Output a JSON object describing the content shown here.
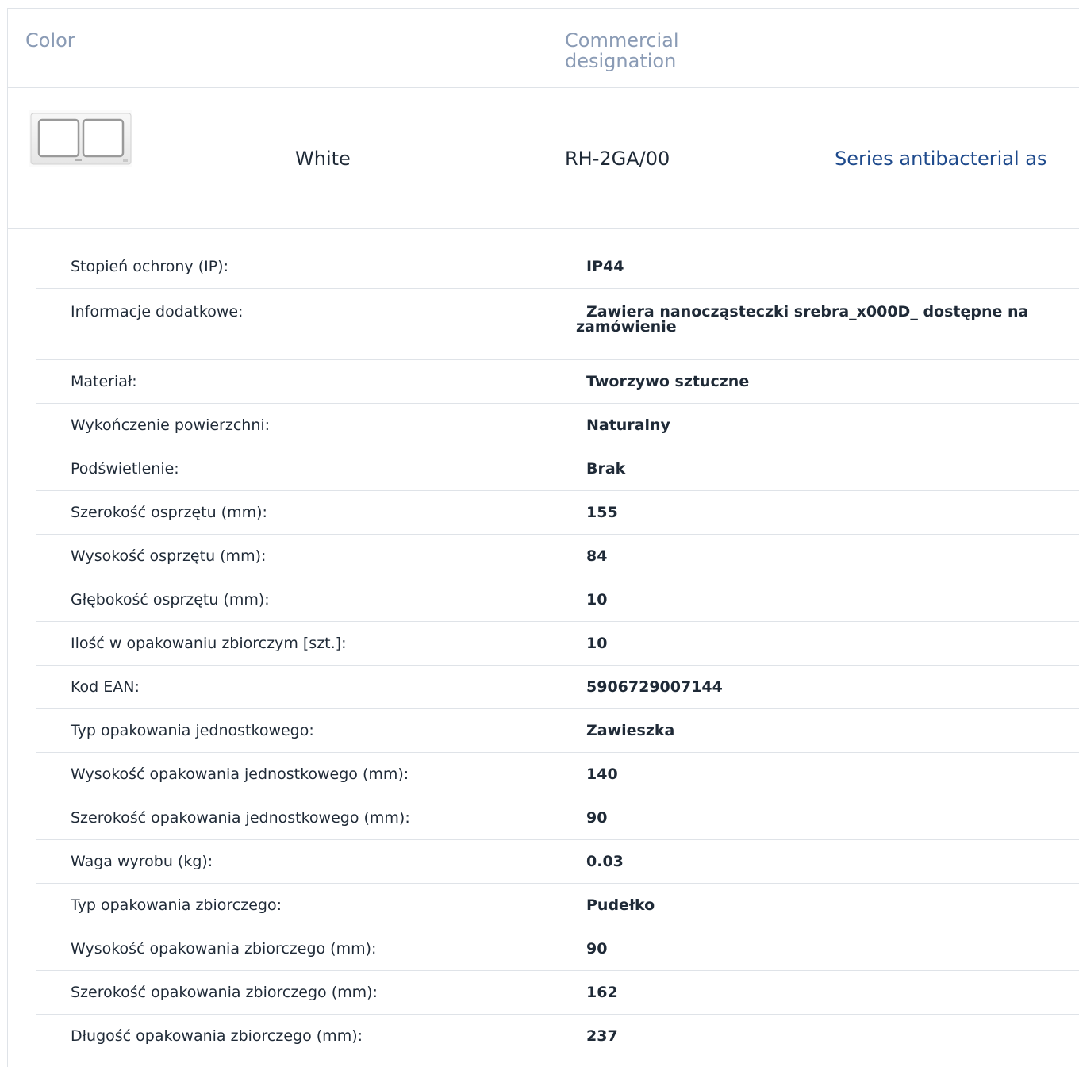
{
  "header": {
    "color_label": "Color",
    "designation_label": "Commercial designation"
  },
  "product": {
    "thumbnail_icon": "double-frame-image",
    "color": "White",
    "code": "RH-2GA/00",
    "series": "Series antibacterial as",
    "series_color": "#1e4a8c"
  },
  "specs": [
    {
      "label": "Stopień ochrony (IP):",
      "value": "IP44"
    },
    {
      "label": "Informacje dodatkowe:",
      "value": "Zawiera nanocząsteczki srebra_x000D_ dostępne na zamówienie"
    },
    {
      "label": "Materiał:",
      "value": "Tworzywo sztuczne"
    },
    {
      "label": "Wykończenie powierzchni:",
      "value": "Naturalny"
    },
    {
      "label": "Podświetlenie:",
      "value": "Brak"
    },
    {
      "label": "Szerokość osprzętu (mm):",
      "value": "155"
    },
    {
      "label": "Wysokość osprzętu (mm):",
      "value": "84"
    },
    {
      "label": "Głębokość osprzętu (mm):",
      "value": "10"
    },
    {
      "label": "Ilość w opakowaniu zbiorczym [szt.]:",
      "value": "10"
    },
    {
      "label": "Kod EAN:",
      "value": "5906729007144"
    },
    {
      "label": "Typ opakowania jednostkowego:",
      "value": "Zawieszka"
    },
    {
      "label": "Wysokość opakowania jednostkowego (mm):",
      "value": "140"
    },
    {
      "label": "Szerokość opakowania jednostkowego (mm):",
      "value": "90"
    },
    {
      "label": "Waga wyrobu (kg):",
      "value": "0.03"
    },
    {
      "label": "Typ opakowania zbiorczego:",
      "value": "Pudełko"
    },
    {
      "label": "Wysokość opakowania zbiorczego (mm):",
      "value": "90"
    },
    {
      "label": "Szerokość opakowania zbiorczego (mm):",
      "value": "162"
    },
    {
      "label": "Długość opakowania zbiorczego (mm):",
      "value": "237"
    }
  ]
}
